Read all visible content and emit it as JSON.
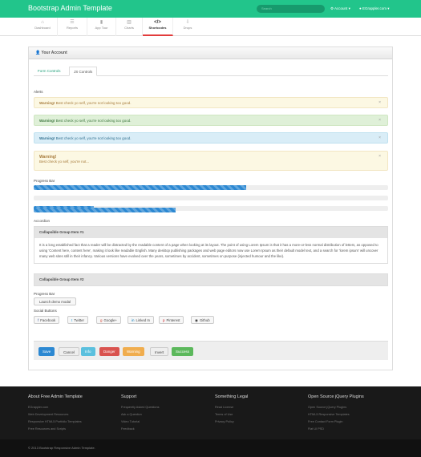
{
  "topbar": {
    "brand": "Bootstrap Admin Template",
    "search_placeholder": "Search",
    "account": "Account",
    "user": "EGrappler.com",
    "brand_color": "#22c58b"
  },
  "nav": [
    {
      "icon": "home-icon",
      "glyph": "⌂",
      "label": "Dashboard"
    },
    {
      "icon": "list-icon",
      "glyph": "☰",
      "label": "Reports"
    },
    {
      "icon": "signal-icon",
      "glyph": "▮",
      "label": "App Tour"
    },
    {
      "icon": "chart-icon",
      "glyph": "▥",
      "label": "Charts"
    },
    {
      "icon": "code-icon",
      "glyph": "</>",
      "label": "Shortcodes"
    },
    {
      "icon": "dropdown-icon",
      "glyph": "⇩",
      "label": "Drops"
    }
  ],
  "widget": {
    "title": "Your Account",
    "tab_form": "Form Controls",
    "tab_js": "JS Controls"
  },
  "alerts": {
    "label": "Alerts",
    "warning_title": "Warning!",
    "warning_text": "Best check yo self, you're not looking too good.",
    "block_text": "Best check yo self, you're not..."
  },
  "progress": {
    "label": "Progress Bar",
    "bars": [
      0.6,
      0.0,
      0.17,
      0.4
    ]
  },
  "accordion": {
    "label": "Accordion",
    "item1": "Collapsible Group Item #1",
    "item1_body": "It is a long established fact that a reader will be distracted by the readable content of a page when looking at its layout. The point of using Lorem Ipsum is that it has a more-or-less normal distribution of letters, as opposed to using 'Content here, content here', making it look like readable English. Many desktop publishing packages and web page editors now use Lorem Ipsum as their default model text, and a search for 'lorem ipsum' will uncover many web sites still in their infancy. Various versions have evolved over the years, sometimes by accident, sometimes on purpose (injected humour and the like).",
    "item2": "Collapsible Group Item #2"
  },
  "modal": {
    "label": "Progress Bar",
    "button": "Launch demo modal"
  },
  "social": {
    "label": "Social Buttons",
    "buttons": [
      "Facebook",
      "Twitter",
      "Google+",
      "Linked In",
      "Pinterest",
      "Github"
    ]
  },
  "actions": [
    "Save",
    "Cancel",
    "Info",
    "Danger",
    "Warning",
    "Invert",
    "Success"
  ],
  "footer": {
    "cols": [
      {
        "title": "About Free Admin Template",
        "links": [
          "EGrappler.com",
          "Web Development Resources",
          "Responsive HTML5 Portfolio Templates",
          "Free Resources and Scripts"
        ]
      },
      {
        "title": "Support",
        "links": [
          "Frequently Asked Questions",
          "Ask a Question",
          "Video Tutorial",
          "Feedback"
        ]
      },
      {
        "title": "Something Legal",
        "links": [
          "Read License",
          "Terms of Use",
          "Privacy Policy"
        ]
      },
      {
        "title": "Open Source jQuery Plugins",
        "links": [
          "Open Source jQuery Plugins",
          "HTML5 Responsive Templates",
          "Free Contact Form Plugin",
          "Flat UI PSD"
        ]
      }
    ],
    "copyright": "© 2013 Bootstrap Responsive Admin Template."
  }
}
